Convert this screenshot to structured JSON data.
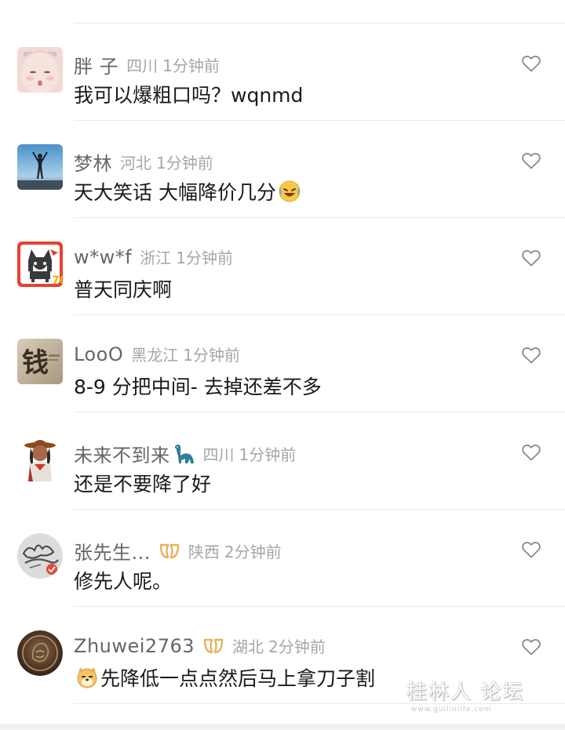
{
  "comments": [
    {
      "username": "胖 子",
      "location": "四川",
      "time": "1分钟前",
      "text": "我可以爆粗口吗？wqnmd",
      "avatar": "baby-face"
    },
    {
      "username": "梦林",
      "location": "河北",
      "time": "1分钟前",
      "text": "天大笑话 大幅降价几分",
      "emoji_after": "laughing-crying-emoji",
      "avatar": "person-silhouette-sky"
    },
    {
      "username": "w*w*f",
      "location": "浙江",
      "time": "1分钟前",
      "text": "普天同庆啊",
      "avatar": "husky-dog"
    },
    {
      "username": "LooO",
      "location": "黑龙江",
      "time": "1分钟前",
      "text": "8-9 分把中间- 去掉还差不多",
      "avatar": "calligraphy-qian",
      "avatar_text": "钱"
    },
    {
      "username": "未来不到来",
      "location": "四川",
      "time": "1分钟前",
      "text": "还是不要降了好",
      "name_icon": "dinosaur-icon",
      "avatar": "cowboy-character"
    },
    {
      "username": "张先生...",
      "location": "陕西",
      "time": "2分钟前",
      "text": "修先人呢。",
      "badge": "gold-badge-icon",
      "avatar": "ink-signature"
    },
    {
      "username": "Zhuwei2763",
      "location": "湖北",
      "time": "2分钟前",
      "text": "先降低一点点然后马上拿刀子割",
      "badge": "gold-badge-icon",
      "emoji_before": "doge-emoji",
      "avatar": "bronze-coin"
    }
  ],
  "watermark": {
    "main": "桂林人 论坛",
    "sub": "www.guilinlife.com"
  },
  "colors": {
    "username": "#666666",
    "meta": "#a6a6a6",
    "text": "#1a1a1a",
    "divider": "#e8e8e8",
    "badge_gold": "#e7b15a"
  }
}
